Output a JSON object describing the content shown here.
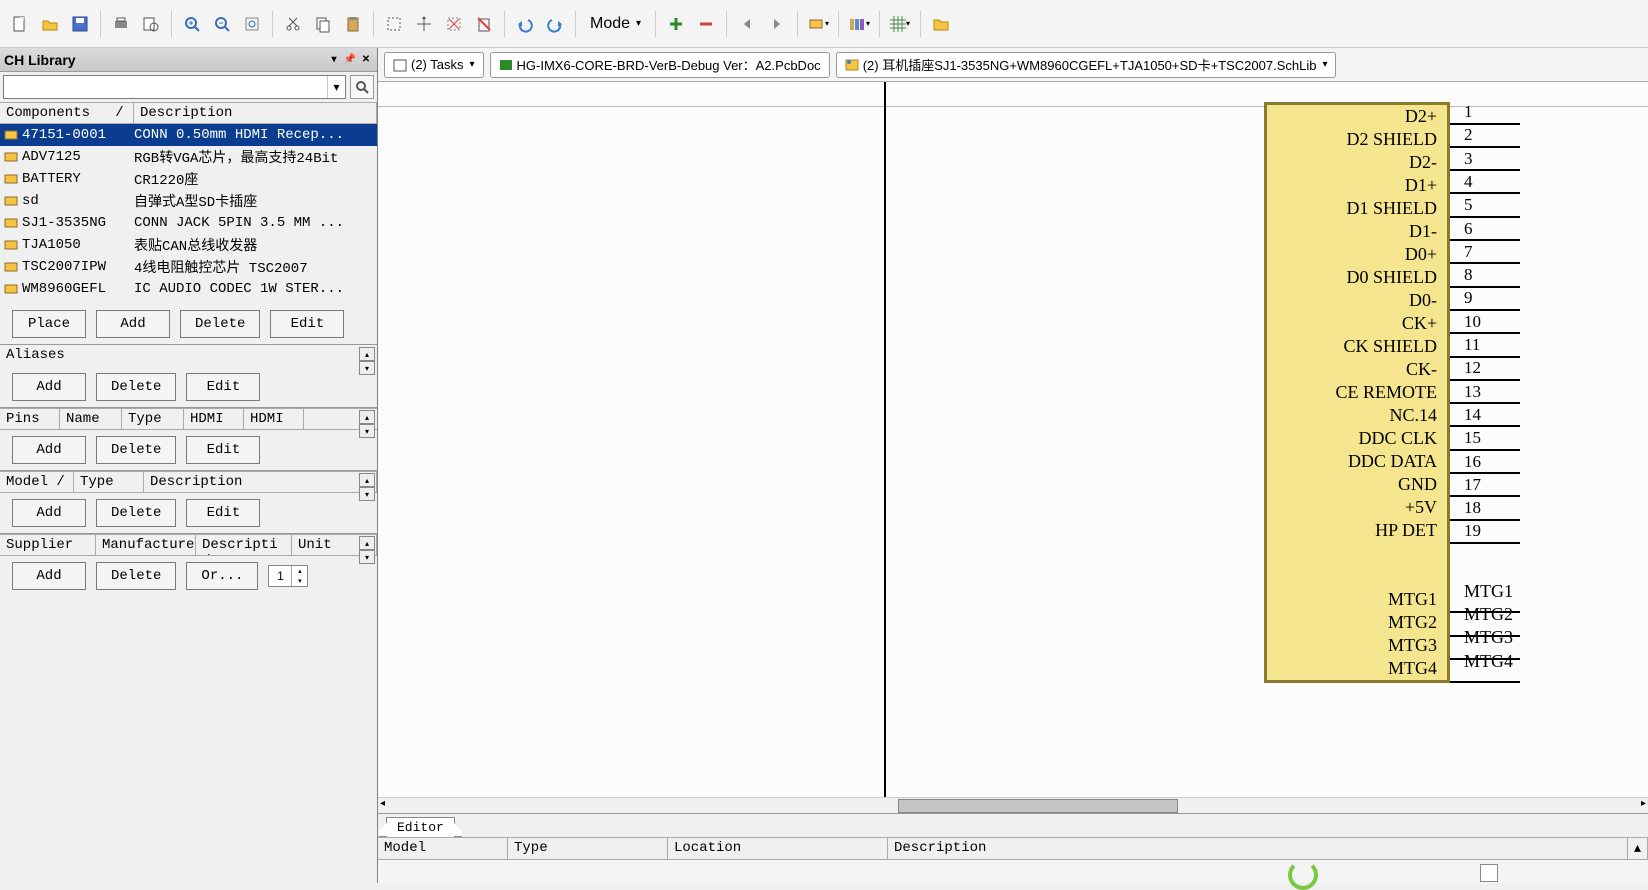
{
  "toolbar": {
    "mode_label": "Mode"
  },
  "panel": {
    "title": "CH Library",
    "comp_header": {
      "name": "Components",
      "desc": "Description"
    },
    "components": [
      {
        "name": "47151-0001",
        "desc": "CONN 0.50mm HDMI Recep...",
        "selected": true
      },
      {
        "name": "ADV7125",
        "desc": "RGB转VGA芯片，最高支持24Bit"
      },
      {
        "name": "BATTERY",
        "desc": "CR1220座"
      },
      {
        "name": "sd",
        "desc": "自弹式A型SD卡插座"
      },
      {
        "name": "SJ1-3535NG",
        "desc": "CONN JACK 5PIN 3.5 MM ..."
      },
      {
        "name": "TJA1050",
        "desc": "表贴CAN总线收发器"
      },
      {
        "name": "TSC2007IPW",
        "desc": "4线电阻触控芯片 TSC2007"
      },
      {
        "name": "WM8960GEFL",
        "desc": "IC AUDIO CODEC 1W STER..."
      }
    ],
    "buttons": {
      "place": "Place",
      "add": "Add",
      "delete": "Delete",
      "edit": "Edit",
      "order": "Or..."
    },
    "aliases_label": "Aliases",
    "pins_header": {
      "pins": "Pins",
      "name": "Name",
      "type": "Type",
      "c4": "HDMI",
      "c5": "HDMI"
    },
    "model_header": {
      "model": "Model",
      "type": "Type",
      "desc": "Description"
    },
    "supplier_header": {
      "supplier": "Supplier",
      "manufacturer": "Manufacturer",
      "desc": "Descripti",
      "unit": "Unit"
    },
    "spinner_value": "1"
  },
  "tabs": {
    "t1": "(2) Tasks",
    "t2": "HG-IMX6-CORE-BRD-VerB-Debug Ver：A2.PcbDoc",
    "t3": "(2) 耳机插座SJ1-3535NG+WM8960CGEFL+TJA1050+SD卡+TSC2007.SchLib"
  },
  "schematic": {
    "pins": [
      "D2+",
      "D2 SHIELD",
      "D2-",
      "D1+",
      "D1 SHIELD",
      "D1-",
      "D0+",
      "D0 SHIELD",
      "D0-",
      "CK+",
      "CK SHIELD",
      "CK-",
      "CE REMOTE",
      "NC.14",
      "DDC CLK",
      "DDC DATA",
      "GND",
      "+5V",
      "HP DET"
    ],
    "mtg_names": [
      "MTG1",
      "MTG2",
      "MTG3",
      "MTG4"
    ],
    "mtg_labels": [
      "MTG1",
      "MTG2",
      "MTG3",
      "MTG4"
    ]
  },
  "editor_tab": "Editor",
  "footer": {
    "model": "Model",
    "type": "Type",
    "location": "Location",
    "desc": "Description"
  }
}
